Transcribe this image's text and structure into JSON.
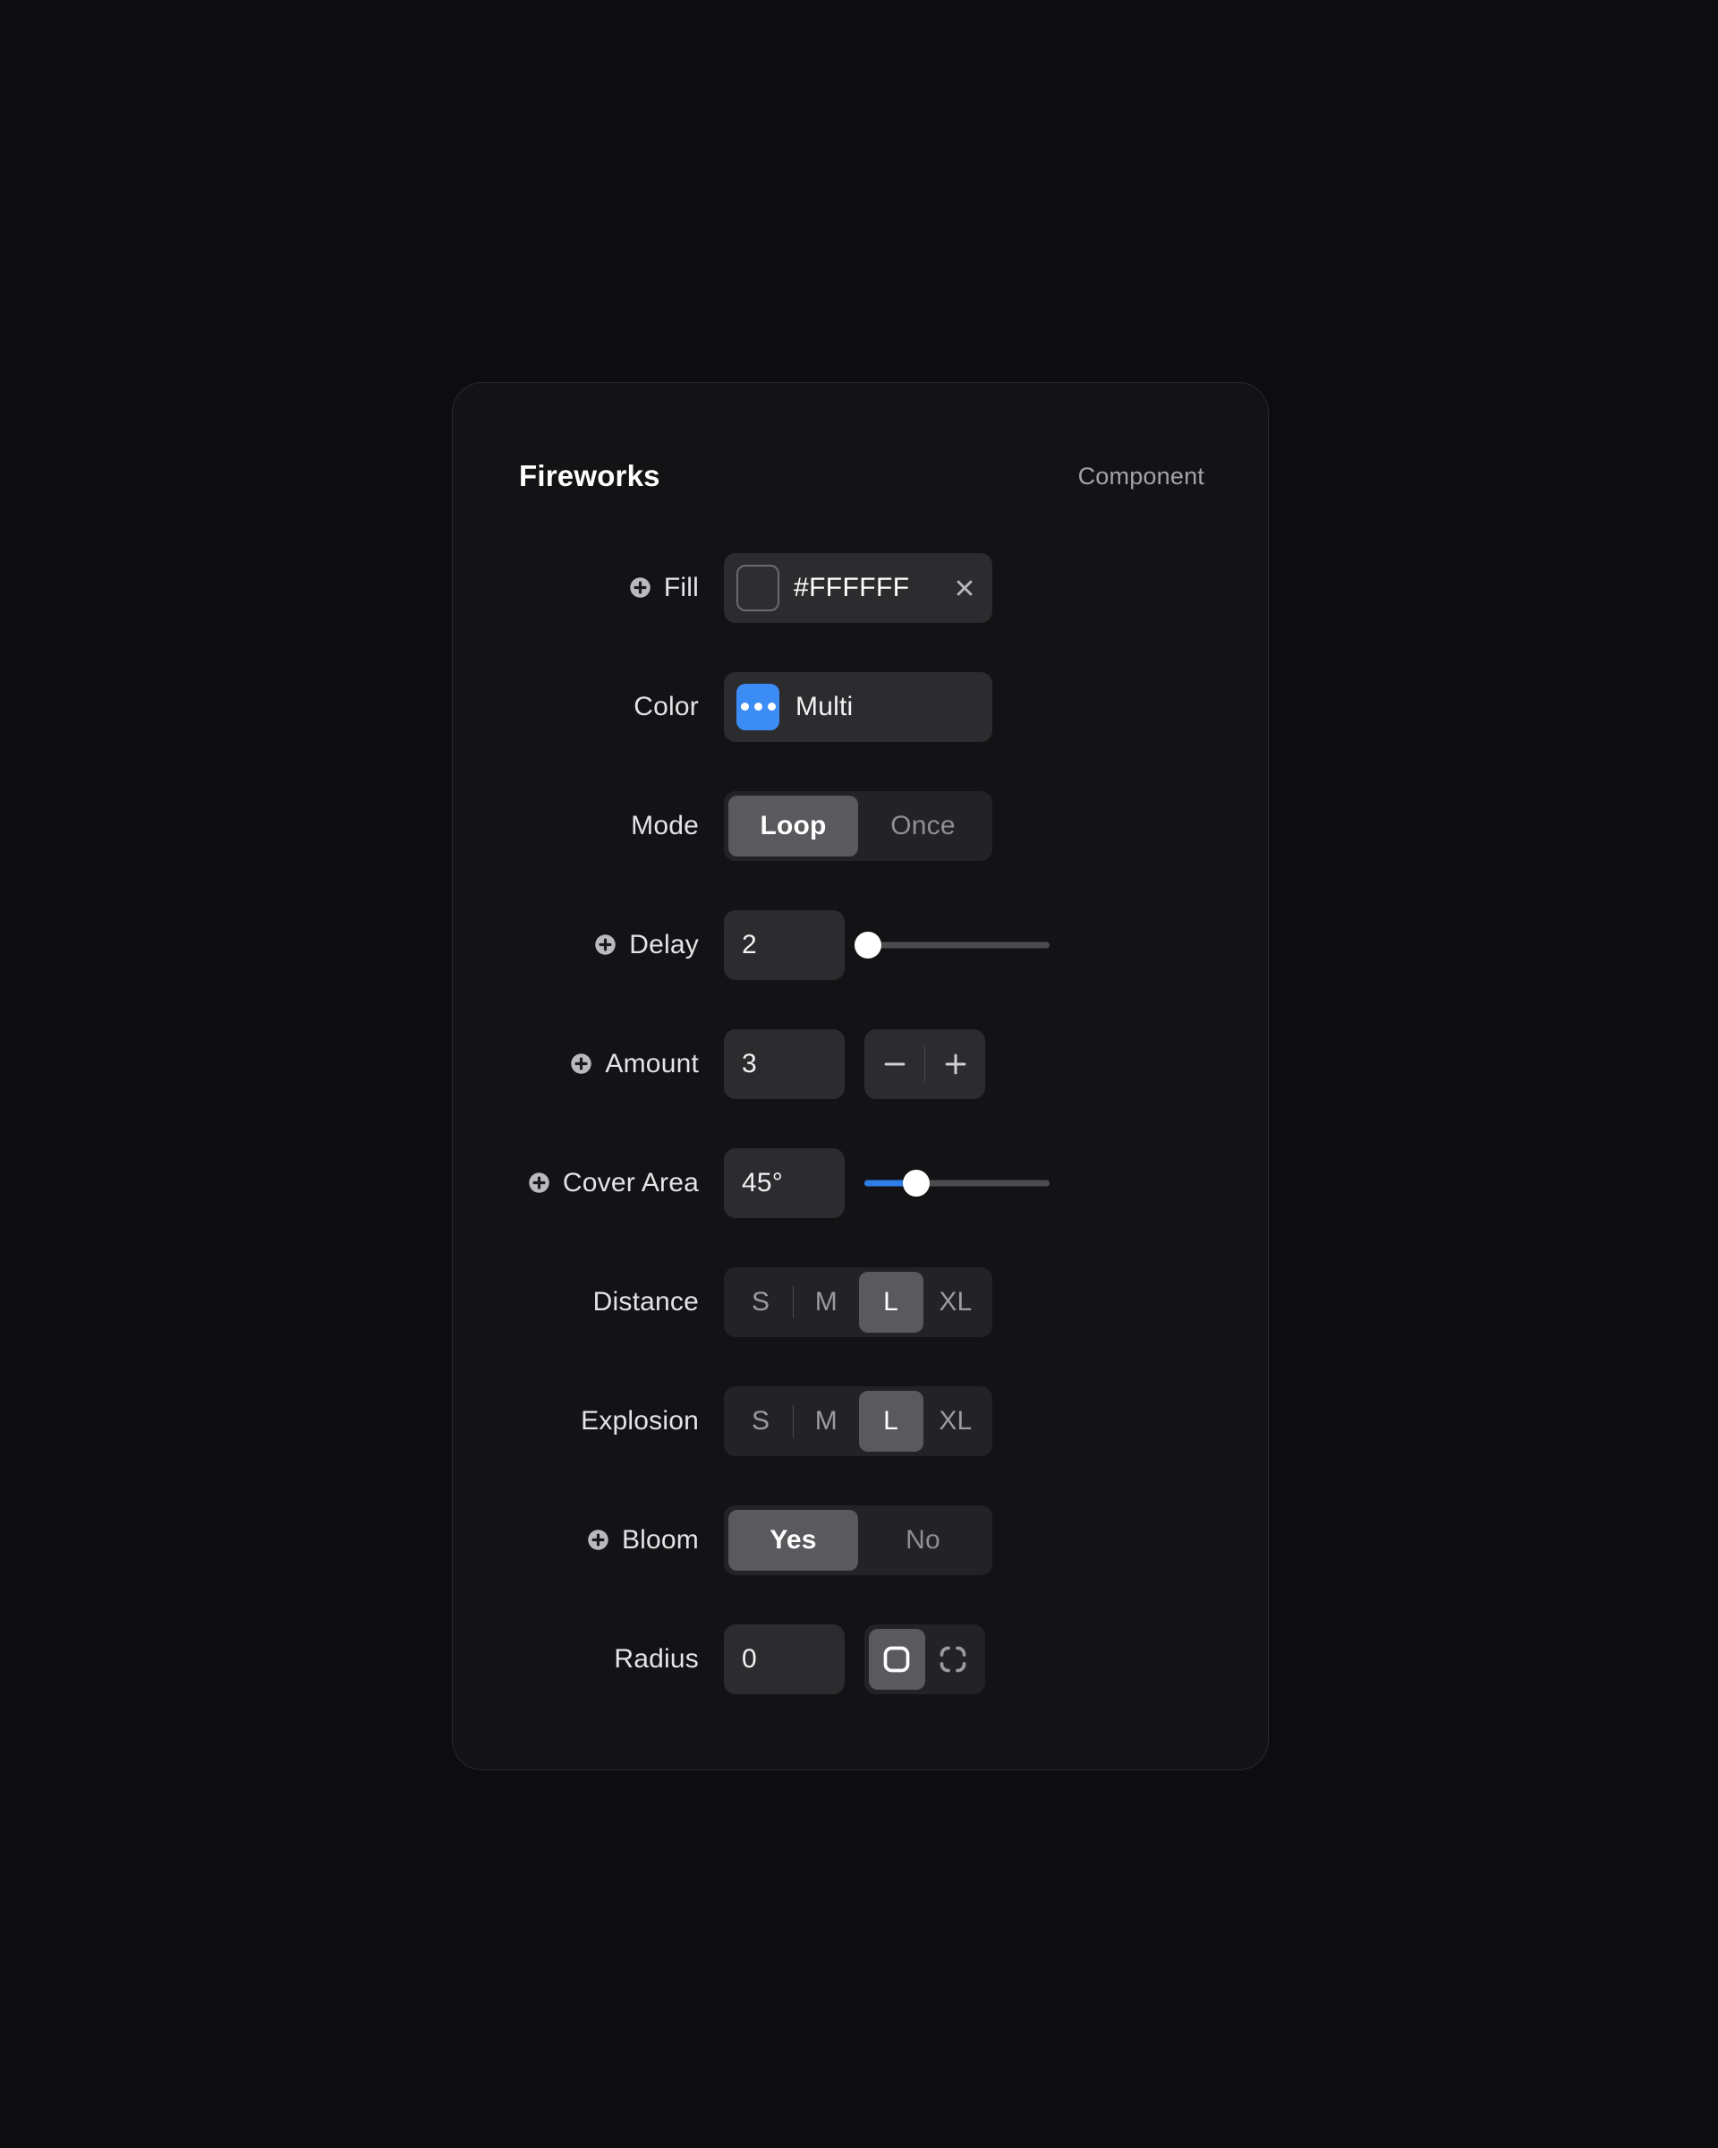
{
  "theme": {
    "page_bg": "#0d0d0f",
    "panel_bg": "#131316",
    "accent_blue": "#3b8cf5",
    "slider_blue": "#2f7fe8",
    "selected_bg": "#5a5a5e",
    "field_bg": "#2c2c2e",
    "track_bg": "#232326"
  },
  "header": {
    "title": "Fireworks",
    "kind": "Component"
  },
  "rows": {
    "fill": {
      "label": "Fill",
      "has_add_icon": true,
      "add_icon": "plus-circle-icon",
      "swatch_icon": "color-swatch",
      "value": "#FFFFFF",
      "clear_icon": "close-icon"
    },
    "color": {
      "label": "Color",
      "has_add_icon": false,
      "swatch_icon": "multi-dots-swatch",
      "value": "Multi"
    },
    "mode": {
      "label": "Mode",
      "has_add_icon": false,
      "options": [
        "Loop",
        "Once"
      ],
      "selected": "Loop"
    },
    "delay": {
      "label": "Delay",
      "has_add_icon": true,
      "add_icon": "plus-circle-icon",
      "value": "2",
      "slider_percent": 2,
      "slider_fill": false
    },
    "amount": {
      "label": "Amount",
      "has_add_icon": true,
      "add_icon": "plus-circle-icon",
      "value": "3",
      "decrement_icon": "minus-icon",
      "increment_icon": "plus-icon"
    },
    "cover_area": {
      "label": "Cover Area",
      "has_add_icon": true,
      "add_icon": "plus-circle-icon",
      "value": "45°",
      "slider_percent": 28,
      "slider_fill": true
    },
    "distance": {
      "label": "Distance",
      "has_add_icon": false,
      "options": [
        "S",
        "M",
        "L",
        "XL"
      ],
      "selected": "L"
    },
    "explosion": {
      "label": "Explosion",
      "has_add_icon": false,
      "options": [
        "S",
        "M",
        "L",
        "XL"
      ],
      "selected": "L"
    },
    "bloom": {
      "label": "Bloom",
      "has_add_icon": true,
      "add_icon": "plus-circle-icon",
      "options": [
        "Yes",
        "No"
      ],
      "selected": "Yes"
    },
    "radius": {
      "label": "Radius",
      "has_add_icon": false,
      "value": "0",
      "modes": [
        "uniform-radius-icon",
        "independent-corners-icon"
      ],
      "selected_mode": "uniform-radius-icon"
    }
  }
}
